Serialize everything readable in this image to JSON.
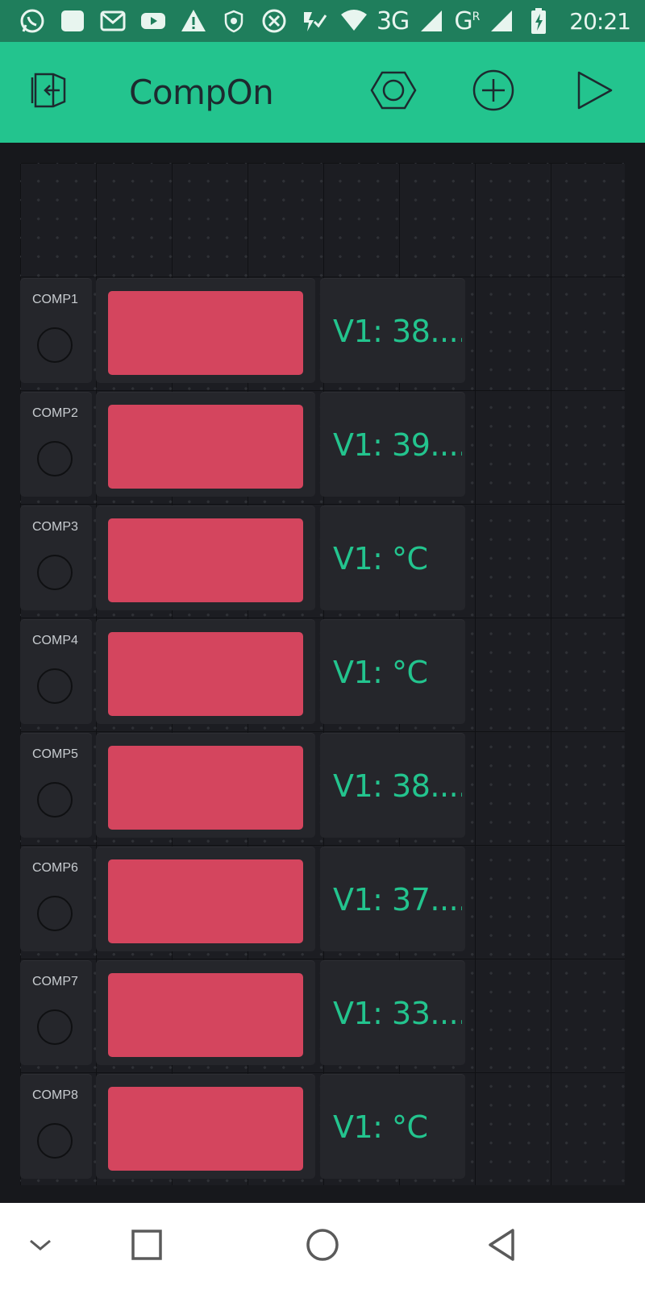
{
  "status_bar": {
    "network_label": "3G",
    "network2_label": "G",
    "network2_sup": "R",
    "time": "20:21"
  },
  "toolbar": {
    "title": "CompOn"
  },
  "rows": [
    {
      "button_label": "COMP1",
      "value": "V1: 38...."
    },
    {
      "button_label": "COMP2",
      "value": "V1: 39...."
    },
    {
      "button_label": "COMP3",
      "value": "V1: °C"
    },
    {
      "button_label": "COMP4",
      "value": "V1: °C"
    },
    {
      "button_label": "COMP5",
      "value": "V1: 38...."
    },
    {
      "button_label": "COMP6",
      "value": "V1: 37...."
    },
    {
      "button_label": "COMP7",
      "value": "V1: 33...."
    },
    {
      "button_label": "COMP8",
      "value": "V1: °C"
    }
  ],
  "colors": {
    "accent": "#23c48e",
    "led": "#d4455e",
    "background": "#17181c",
    "widget": "#25262b"
  }
}
